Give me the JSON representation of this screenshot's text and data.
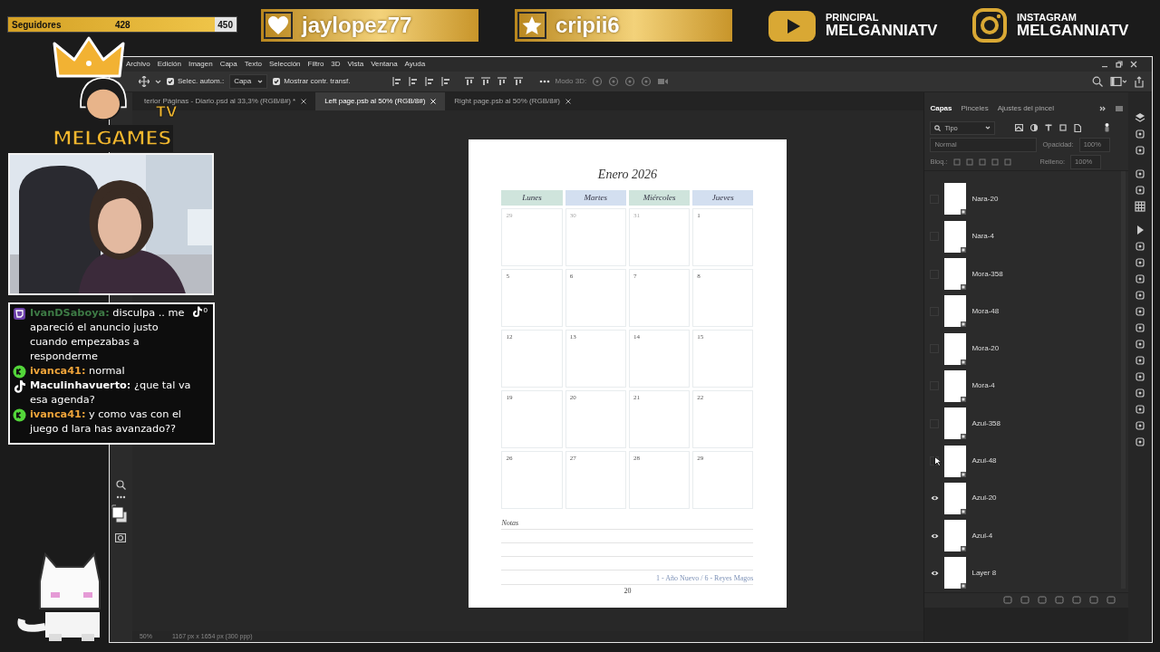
{
  "overlay": {
    "followers": {
      "label": "Seguidores",
      "count": "428",
      "goal": "450",
      "level": 0.951
    },
    "banners": [
      {
        "kind": "heart",
        "name": "jaylopez77"
      },
      {
        "kind": "star",
        "name": "cripii6"
      }
    ],
    "socials": [
      {
        "kind": "youtube",
        "caption": "PRINCIPAL",
        "handle": "MELGANNIATV"
      },
      {
        "kind": "instagram",
        "caption": "INSTAGRAM",
        "handle": "MELGANNIATV"
      }
    ],
    "logo": {
      "title": "MELGAMES",
      "badge": "TV"
    },
    "chat": {
      "tiktok_count": "0",
      "messages": [
        {
          "kind": "twitch",
          "user": "IvanDSaboya:",
          "color": "#3d7a45",
          "text": "disculpa .. me apareció el anuncio justo cuando empezabas a responderme"
        },
        {
          "kind": "kick",
          "user": "ivanca41:",
          "color": "#f0a43a",
          "text": "normal"
        },
        {
          "kind": "tiktok",
          "user": "Maculinhavuerto:",
          "color": "#ffffff",
          "text": "¿que tal va esa agenda?"
        },
        {
          "kind": "kick",
          "user": "ivanca41:",
          "color": "#f0a43a",
          "text": "y como vas con el juego d lara has avanzado??"
        }
      ]
    }
  },
  "photoshop": {
    "menu": [
      "Archivo",
      "Edición",
      "Imagen",
      "Capa",
      "Texto",
      "Selección",
      "Filtro",
      "3D",
      "Vista",
      "Ventana",
      "Ayuda"
    ],
    "options": {
      "auto_select": {
        "label": "Selec. autom.:",
        "checked": true
      },
      "auto_select_target": "Capa",
      "show_transform": {
        "label": "Mostrar contr. transf.",
        "checked": true
      },
      "mode_3d": "Modo 3D:"
    },
    "tabs": [
      {
        "label": "terior Páginas - Diario.psd al 33,3% (RGB/8#) *",
        "selected": false
      },
      {
        "label": "Left page.psb al 50% (RGB/8#)",
        "selected": true
      },
      {
        "label": "Right page.psb al 50% (RGB/8#)",
        "selected": false
      }
    ],
    "document": {
      "title": "Enero 2026",
      "days": [
        {
          "label": "Lunes",
          "color": "#cfe4dc"
        },
        {
          "label": "Martes",
          "color": "#d3dff0"
        },
        {
          "label": "Miércoles",
          "color": "#cfe4dc"
        },
        {
          "label": "Jueves",
          "color": "#d3dff0"
        }
      ],
      "weeks": [
        [
          {
            "day": "29",
            "outside": true
          },
          {
            "day": "30",
            "outside": true
          },
          {
            "day": "31",
            "outside": true
          },
          {
            "day": "1",
            "outside": false
          }
        ],
        [
          {
            "day": "5",
            "outside": false
          },
          {
            "day": "6",
            "outside": false
          },
          {
            "day": "7",
            "outside": false
          },
          {
            "day": "8",
            "outside": false
          }
        ],
        [
          {
            "day": "12",
            "outside": false
          },
          {
            "day": "13",
            "outside": false
          },
          {
            "day": "14",
            "outside": false
          },
          {
            "day": "15",
            "outside": false
          }
        ],
        [
          {
            "day": "19",
            "outside": false
          },
          {
            "day": "20",
            "outside": false
          },
          {
            "day": "21",
            "outside": false
          },
          {
            "day": "22",
            "outside": false
          }
        ],
        [
          {
            "day": "26",
            "outside": false
          },
          {
            "day": "27",
            "outside": false
          },
          {
            "day": "28",
            "outside": false
          },
          {
            "day": "29",
            "outside": false
          }
        ]
      ],
      "notes_label": "Notas",
      "holidays": "1 - Año Nuevo / 6 - Reyes Magos",
      "page_number": "20"
    },
    "status": {
      "zoom": "50%",
      "size": "1167 px x 1654 px (300 ppp)"
    },
    "layers_panel": {
      "tabs": [
        {
          "label": "Capas",
          "selected": true
        },
        {
          "label": "Pinceles",
          "selected": false
        },
        {
          "label": "Ajustes del pincel",
          "selected": false
        }
      ],
      "filter": "Tipo",
      "blend": "Normal",
      "opacity_label": "Opacidad:",
      "opacity": "100%",
      "lock_label": "Bloq.:",
      "fill_label": "Relleno:",
      "fill": "100%",
      "disabled": true,
      "layers": [
        {
          "name": "Nara-20",
          "visible": false
        },
        {
          "name": "Nara-4",
          "visible": false
        },
        {
          "name": "Mora-358",
          "visible": false
        },
        {
          "name": "Mora-48",
          "visible": false
        },
        {
          "name": "Mora-20",
          "visible": false
        },
        {
          "name": "Mora-4",
          "visible": false
        },
        {
          "name": "Azul-358",
          "visible": false
        },
        {
          "name": "Azul-48",
          "visible": false
        },
        {
          "name": "Azul-20",
          "visible": true
        },
        {
          "name": "Azul-4",
          "visible": true
        },
        {
          "name": "Layer 8",
          "visible": true
        }
      ]
    }
  }
}
